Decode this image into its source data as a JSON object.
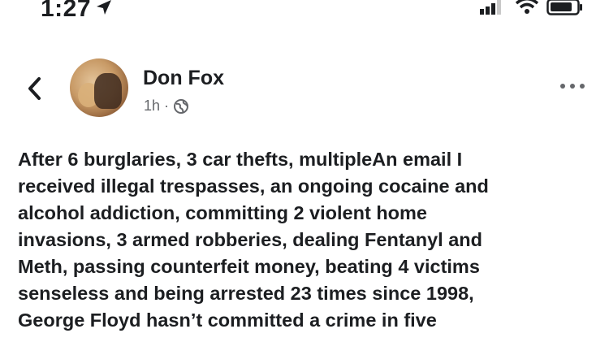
{
  "status_bar": {
    "time": "1:27",
    "location_icon": "location-arrow-icon",
    "signal_icon": "cellular-signal-icon",
    "wifi_icon": "wifi-icon",
    "battery_icon": "battery-icon"
  },
  "post": {
    "back_icon": "chevron-left-icon",
    "author": "Don Fox",
    "time_ago": "1h",
    "separator": "·",
    "audience_icon": "globe-icon",
    "more_icon": "more-options-icon",
    "lines": [
      "After 6 burglaries, 3 car thefts, multipleAn email  I",
      "received illegal trespasses, an ongoing cocaine and",
      "alcohol addiction, committing 2 violent home",
      "invasions, 3 armed robberies, dealing Fentanyl and",
      "Meth, passing counterfeit money, beating 4 victims",
      "senseless and being arrested 23 times since 1998,",
      "George Floyd hasn’t committed a crime in five"
    ]
  },
  "colors": {
    "text": "#1c1e21",
    "secondary_text": "#65676b",
    "background": "#ffffff"
  }
}
